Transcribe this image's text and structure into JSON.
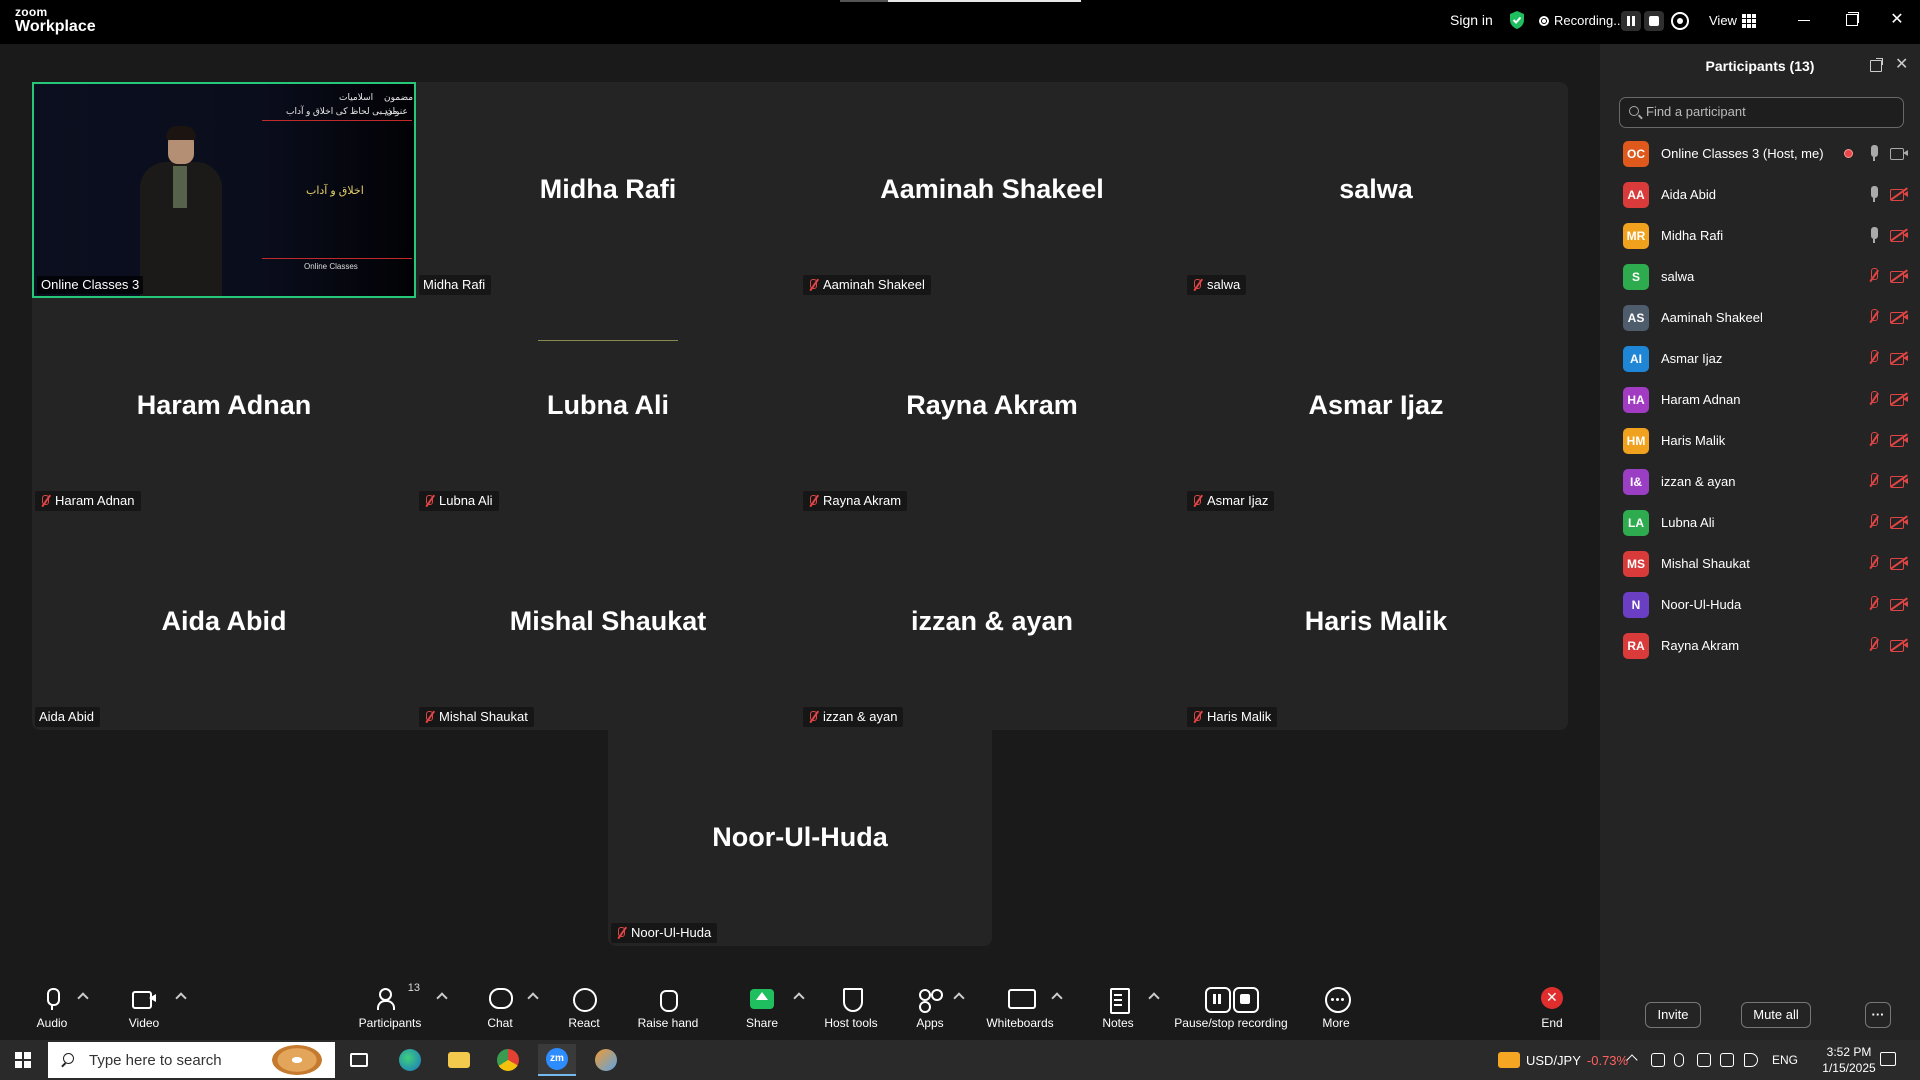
{
  "titlebar": {
    "logo_top": "zoom",
    "logo_bottom": "Workplace",
    "sign_in": "Sign in",
    "recording_label": "Recording...",
    "view_label": "View"
  },
  "gallery": {
    "presenter": {
      "label": "Online Classes 3",
      "slide_top": "مضمون",
      "slide_top2": "اسلامیات",
      "slide_mid": "عنوان",
      "slide_mid2": "مذہبی لحاظ کی اخلاق و آداب",
      "slide_center": "اخلاق و آداب",
      "slide_logo": "Online Classes"
    },
    "tiles": [
      {
        "name": "Midha Rafi",
        "label": "Midha Rafi",
        "muted": false
      },
      {
        "name": "Aaminah Shakeel",
        "label": "Aaminah Shakeel",
        "muted": true
      },
      {
        "name": "salwa",
        "label": "salwa",
        "muted": true
      },
      {
        "name": "Haram Adnan",
        "label": "Haram Adnan",
        "muted": true
      },
      {
        "name": "Lubna Ali",
        "label": "Lubna Ali",
        "muted": true
      },
      {
        "name": "Rayna Akram",
        "label": "Rayna Akram",
        "muted": true
      },
      {
        "name": "Asmar Ijaz",
        "label": "Asmar Ijaz",
        "muted": true
      },
      {
        "name": "Aida Abid",
        "label": "Aida Abid",
        "muted": false
      },
      {
        "name": "Mishal Shaukat",
        "label": "Mishal Shaukat",
        "muted": true
      },
      {
        "name": "izzan & ayan",
        "label": "izzan & ayan",
        "muted": true
      },
      {
        "name": "Haris Malik",
        "label": "Haris Malik",
        "muted": true
      },
      {
        "name": "Noor-Ul-Huda",
        "label": "Noor-Ul-Huda",
        "muted": true
      }
    ]
  },
  "toolbar": {
    "audio": "Audio",
    "video": "Video",
    "participants": "Participants",
    "participants_count": "13",
    "chat": "Chat",
    "react": "React",
    "raise_hand": "Raise hand",
    "share": "Share",
    "host_tools": "Host tools",
    "apps": "Apps",
    "whiteboards": "Whiteboards",
    "notes": "Notes",
    "pause_stop": "Pause/stop recording",
    "more": "More",
    "end": "End"
  },
  "panel": {
    "title": "Participants (13)",
    "search_placeholder": "Find a participant",
    "participants": [
      {
        "initials": "OC",
        "name": "Online Classes 3 (Host, me)",
        "color": "#e0591c",
        "mic": "on",
        "cam": "on",
        "rec": true
      },
      {
        "initials": "AA",
        "name": "Aida Abid",
        "color": "#d93a3a",
        "mic": "on",
        "cam": "off"
      },
      {
        "initials": "MR",
        "name": "Midha Rafi",
        "color": "#f0a21e",
        "mic": "on",
        "cam": "off"
      },
      {
        "initials": "S",
        "name": "salwa",
        "color": "#2eab4e",
        "mic": "muted",
        "cam": "off"
      },
      {
        "initials": "AS",
        "name": "Aaminah Shakeel",
        "color": "#4f5c6b",
        "mic": "muted",
        "cam": "off"
      },
      {
        "initials": "AI",
        "name": "Asmar Ijaz",
        "color": "#1f86d6",
        "mic": "muted",
        "cam": "off"
      },
      {
        "initials": "HA",
        "name": "Haram Adnan",
        "color": "#a03bc2",
        "mic": "muted",
        "cam": "off"
      },
      {
        "initials": "HM",
        "name": "Haris Malik",
        "color": "#f0a21e",
        "mic": "muted",
        "cam": "off"
      },
      {
        "initials": "I&",
        "name": "izzan & ayan",
        "color": "#9a3fc4",
        "mic": "muted",
        "cam": "off"
      },
      {
        "initials": "LA",
        "name": "Lubna Ali",
        "color": "#2eab4e",
        "mic": "muted",
        "cam": "off"
      },
      {
        "initials": "MS",
        "name": "Mishal Shaukat",
        "color": "#d93a3a",
        "mic": "muted",
        "cam": "off"
      },
      {
        "initials": "N",
        "name": "Noor-Ul-Huda",
        "color": "#6a3fc4",
        "mic": "muted",
        "cam": "off"
      },
      {
        "initials": "RA",
        "name": "Rayna Akram",
        "color": "#d93a3a",
        "mic": "muted",
        "cam": "off"
      }
    ],
    "invite": "Invite",
    "mute_all": "Mute all",
    "more_dots": "···"
  },
  "taskbar": {
    "search_placeholder": "Type here to search",
    "ticker": "USD/JPY",
    "ticker_change": "-0.73%",
    "lang": "ENG",
    "time": "3:52 PM",
    "date": "1/15/2025"
  }
}
